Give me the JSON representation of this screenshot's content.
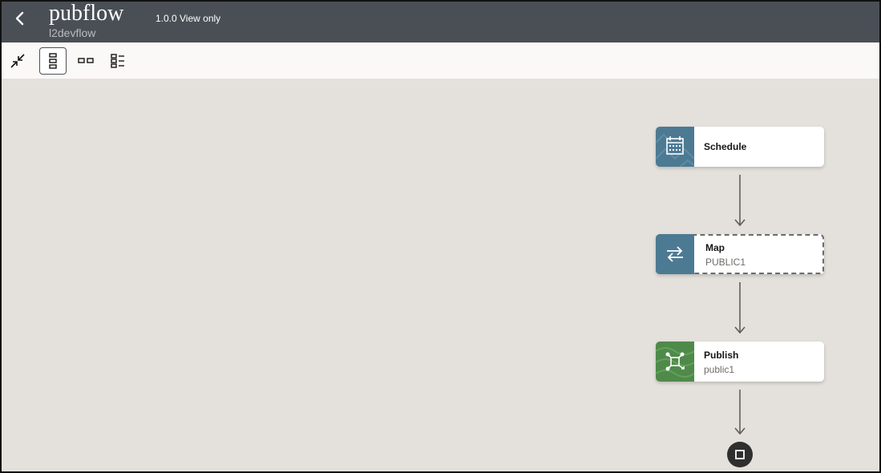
{
  "header": {
    "title": "pubflow",
    "subtitle": "l2devflow",
    "version": "1.0.0 View only"
  },
  "toolbar": {
    "buttons": [
      "collapse",
      "vertical-layout",
      "horizontal-layout",
      "detail-layout"
    ],
    "active": "vertical-layout"
  },
  "flow": {
    "nodes": [
      {
        "title": "Schedule",
        "subtitle": "",
        "icon": "calendar-icon",
        "color": "#4c7a93"
      },
      {
        "title": "Map",
        "subtitle": "PUBLIC1",
        "icon": "swap-arrows-icon",
        "color": "#4c7a93"
      },
      {
        "title": "Publish",
        "subtitle": "public1",
        "icon": "publish-network-icon",
        "color": "#4f8a4a"
      }
    ],
    "end": "stop-icon"
  },
  "colors": {
    "header_bg": "#4a4f56",
    "canvas_bg": "#e4e0db",
    "schedule_tile": "#4c7a93",
    "publish_tile": "#4f8a4a"
  }
}
